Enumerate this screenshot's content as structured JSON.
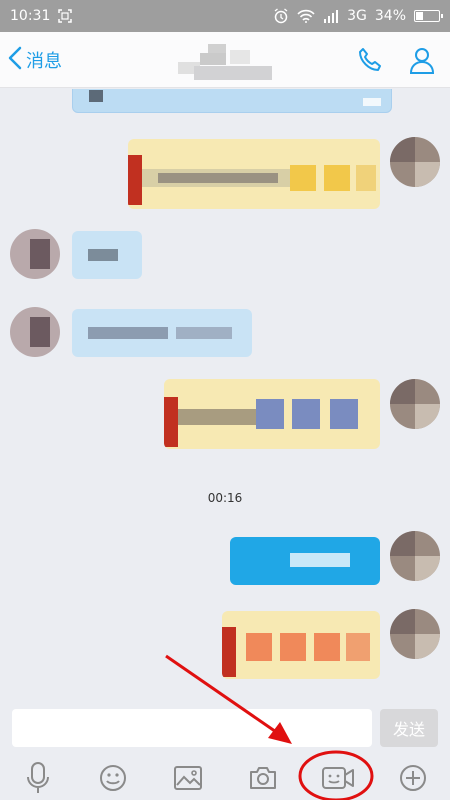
{
  "status_bar": {
    "time": "10:31",
    "network": "3G",
    "battery": "34%",
    "battery_level": 0.34,
    "icons": [
      "screenshot-icon",
      "alarm-icon",
      "wifi-icon",
      "signal-icon",
      "battery-icon"
    ]
  },
  "header": {
    "back_label": "消息",
    "icons": [
      "back-chevron-icon",
      "phone-icon",
      "contact-profile-icon"
    ]
  },
  "chat": {
    "timestamp": "00:16",
    "colors": {
      "outgoing_yellow": "#f7e9b3",
      "incoming_blue": "#c9e3f5",
      "outgoing_blue": "#20a7e6",
      "background": "#ebedf2"
    }
  },
  "input": {
    "placeholder": "",
    "send_label": "发送"
  },
  "toolbar": {
    "icons": [
      "microphone-icon",
      "emoji-icon",
      "image-icon",
      "camera-icon",
      "video-chat-icon",
      "add-icon"
    ]
  },
  "annotation": {
    "color": "#e01010"
  }
}
